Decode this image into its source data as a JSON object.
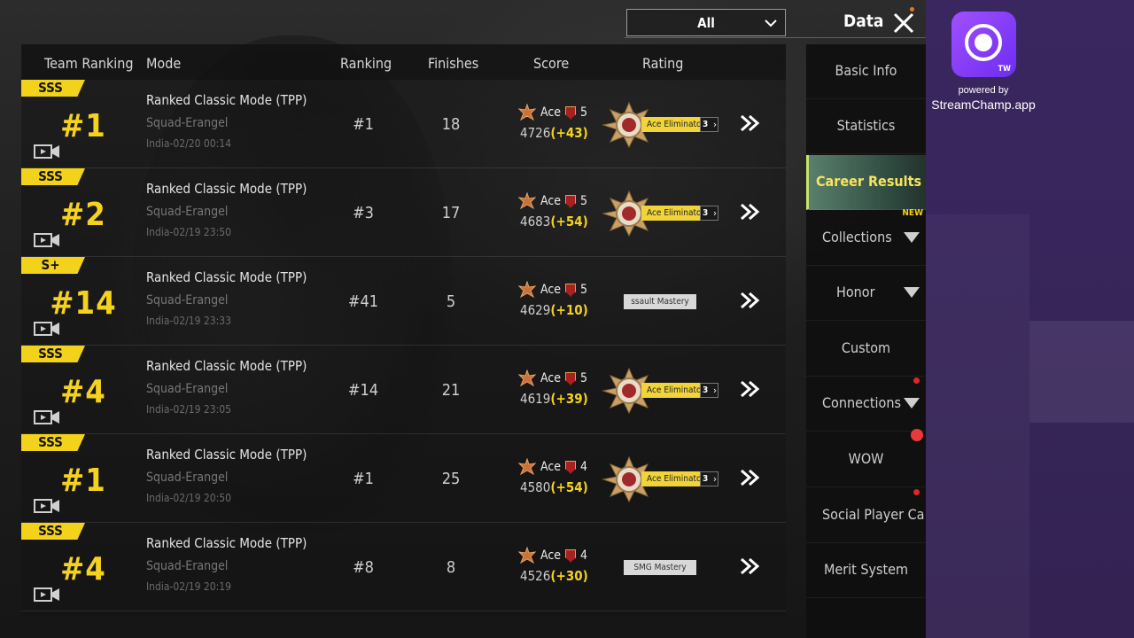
{
  "header": {
    "filter_value": "All",
    "title": "Data"
  },
  "table": {
    "columns": [
      "Team Ranking",
      "Mode",
      "Ranking",
      "Finishes",
      "Score",
      "Rating"
    ],
    "rows": [
      {
        "tier": "SSS",
        "team_rank": "#1",
        "mode": "Ranked Classic Mode (TPP)",
        "map": "Squad-Erangel",
        "server_time": "India-02/20 00:14",
        "ranking": "#1",
        "finishes": "18",
        "tier_name": "Ace",
        "tier_level": "5",
        "score": "4726",
        "delta": "(+43)",
        "rating": "Ace Eliminator",
        "rating_count": "3",
        "rating_type": "medal"
      },
      {
        "tier": "SSS",
        "team_rank": "#2",
        "mode": "Ranked Classic Mode (TPP)",
        "map": "Squad-Erangel",
        "server_time": "India-02/19 23:50",
        "ranking": "#3",
        "finishes": "17",
        "tier_name": "Ace",
        "tier_level": "5",
        "score": "4683",
        "delta": "(+54)",
        "rating": "Ace Eliminator",
        "rating_count": "3",
        "rating_type": "medal"
      },
      {
        "tier": "S+",
        "team_rank": "#14",
        "mode": "Ranked Classic Mode (TPP)",
        "map": "Squad-Erangel",
        "server_time": "India-02/19 23:33",
        "ranking": "#41",
        "finishes": "5",
        "tier_name": "Ace",
        "tier_level": "5",
        "score": "4629",
        "delta": "(+10)",
        "rating": "ssault Mastery",
        "rating_count": "",
        "rating_type": "mastery"
      },
      {
        "tier": "SSS",
        "team_rank": "#4",
        "mode": "Ranked Classic Mode (TPP)",
        "map": "Squad-Erangel",
        "server_time": "India-02/19 23:05",
        "ranking": "#14",
        "finishes": "21",
        "tier_name": "Ace",
        "tier_level": "5",
        "score": "4619",
        "delta": "(+39)",
        "rating": "Ace Eliminator",
        "rating_count": "3",
        "rating_type": "medal"
      },
      {
        "tier": "SSS",
        "team_rank": "#1",
        "mode": "Ranked Classic Mode (TPP)",
        "map": "Squad-Erangel",
        "server_time": "India-02/19 20:50",
        "ranking": "#1",
        "finishes": "25",
        "tier_name": "Ace",
        "tier_level": "4",
        "score": "4580",
        "delta": "(+54)",
        "rating": "Ace Eliminator",
        "rating_count": "3",
        "rating_type": "medal"
      },
      {
        "tier": "SSS",
        "team_rank": "#4",
        "mode": "Ranked Classic Mode (TPP)",
        "map": "Squad-Erangel",
        "server_time": "India-02/19 20:19",
        "ranking": "#8",
        "finishes": "8",
        "tier_name": "Ace",
        "tier_level": "4",
        "score": "4526",
        "delta": "(+30)",
        "rating": "SMG Mastery",
        "rating_count": "",
        "rating_type": "mastery"
      }
    ]
  },
  "menu": {
    "items": [
      {
        "label": "Basic Info"
      },
      {
        "label": "Statistics"
      },
      {
        "label": "Career Results"
      },
      {
        "label": "Collections"
      },
      {
        "label": "Honor"
      },
      {
        "label": "Custom"
      },
      {
        "label": "Connections"
      },
      {
        "label": "WOW"
      },
      {
        "label": "Social Player Ca"
      },
      {
        "label": "Merit System"
      }
    ],
    "new_badge": "NEW"
  },
  "overlay": {
    "logo_badge": "TW",
    "powered_by": "powered by",
    "domain": "StreamChamp.app"
  },
  "colors": {
    "accent_yellow": "#f5d21e",
    "active_menu_text": "#f7e45e",
    "side_panel": "#3b2760",
    "logo_purple": "#8e3cff"
  }
}
